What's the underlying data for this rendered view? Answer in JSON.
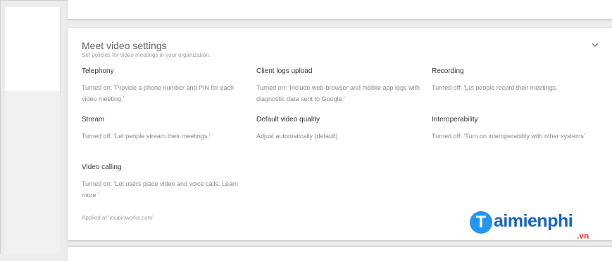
{
  "section": {
    "title": "Meet video settings",
    "subtitle": "Set policies for video meetings in your organization."
  },
  "settings": [
    {
      "label": "Telephony",
      "desc": "Turned on: 'Provide a phone number and PIN for each video meeting.'"
    },
    {
      "label": "Client logs upload",
      "desc": "Turned on: 'Include web-browser and mobile app logs with diagnostic data sent to Google.'"
    },
    {
      "label": "Recording",
      "desc": "Turned off: 'Let people record their meetings.'"
    },
    {
      "label": "Stream",
      "desc": "Turned off: 'Let people stream their meetings.'"
    },
    {
      "label": "Default video quality",
      "desc": "Adjust automatically (default)"
    },
    {
      "label": "Interoperability",
      "desc": "Turned off: 'Turn on interoperability with other systems'"
    },
    {
      "label": "Video calling",
      "desc": "Turned on: 'Let users place video and voice calls. Learn more '"
    }
  ],
  "applied_at": "Applied at 'incipioworks.com'",
  "watermark": {
    "initial": "T",
    "text": "aimienphi",
    "suffix": ".vn"
  },
  "icons": {
    "expand": "chevron-down-icon"
  },
  "colors": {
    "brand_blue": "#1565c0",
    "brand_red": "#e53935"
  }
}
